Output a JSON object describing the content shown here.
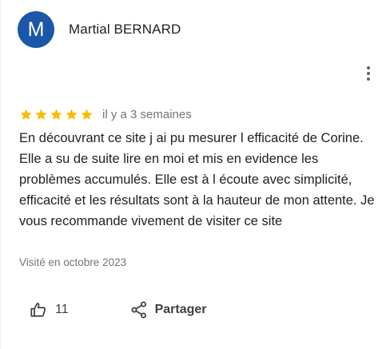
{
  "author": {
    "avatar_letter": "M",
    "avatar_color": "#1a57a8",
    "name": "Martial BERNARD"
  },
  "menu": {
    "icon": "more-vert-icon"
  },
  "rating": {
    "stars": 5,
    "max_stars": 5,
    "star_color": "#fbbc04",
    "date": "il y a 3 semaines"
  },
  "review": {
    "text": "En découvrant ce site j ai pu mesurer l efficacité  de Corine. Elle a su de suite lire en moi et mis en evidence les problèmes accumulés. Elle est à l  écoute avec simplicité, efficacité et les résultats sont à la hauteur de mon attente. Je vous recommande vivement de visiter ce site",
    "visit": "Visité en octobre 2023"
  },
  "actions": {
    "like_icon": "thumb-up-icon",
    "like_count": "11",
    "share_icon": "share-icon",
    "share_label": "Partager"
  }
}
